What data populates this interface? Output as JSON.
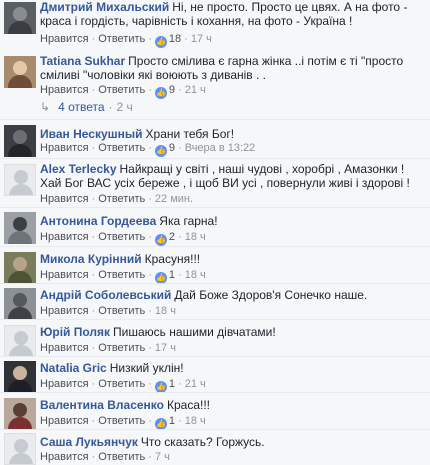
{
  "actions": {
    "like": "Нравится",
    "reply": "Ответить",
    "sep": "·"
  },
  "comments": [
    {
      "author": "Дмитрий Михальский",
      "text": "Ні, не просто. Просто це цвях. А на фото - краса і гордість, чарівність і кохання, на фото - Україна !",
      "likes": "18",
      "time": "17 ч",
      "avatar": "photo-dark"
    },
    {
      "author": "Tatiana Sukhar",
      "text": "Просто смілива є гарна жінка ..і потім є ті \"просто сміливі \"чоловіки які воюють з диванів . .",
      "likes": "9",
      "time": "21 ч",
      "avatar": "photo-warm"
    },
    {
      "author": "Иван Нескушный",
      "text": "Храни тебя Бог!",
      "likes": "9",
      "time": "Вчера в 13:22",
      "avatar": "photo-dark"
    },
    {
      "author": "Alex Terlecky",
      "text": "Найкращі у світі , наші чудові , хоробрі , Амазонки ! Хай Бог ВАС усіх береже , і щоб ВИ усі , повернули живі і здорові !",
      "likes": "",
      "time": "22 мин.",
      "avatar": "blank"
    },
    {
      "author": "Антонина Гордеева",
      "text": "Яка гарна!",
      "likes": "2",
      "time": "18 ч",
      "avatar": "photo-grey"
    },
    {
      "author": "Микола Курінний",
      "text": "Красуня!!!",
      "likes": "1",
      "time": "18 ч",
      "avatar": "photo-olive"
    },
    {
      "author": "Андрій Соболевський",
      "text": "Дай Боже Здоров'я Сонечко наше.",
      "likes": "",
      "time": "18 ч",
      "avatar": "photo-grey"
    },
    {
      "author": "Юрій Поляк",
      "text": "Пишаюсь нашими дівчатами!",
      "likes": "",
      "time": "17 ч",
      "avatar": "blank"
    },
    {
      "author": "Natalia Gric",
      "text": "Низкий уклін!",
      "likes": "1",
      "time": "21 ч",
      "avatar": "photo-dark"
    },
    {
      "author": "Валентина Власенко",
      "text": "Краса!!!",
      "likes": "1",
      "time": "18 ч",
      "avatar": "photo-warm"
    },
    {
      "author": "Саша Лукьянчук",
      "text": "Что сказать? Горжусь.",
      "likes": "",
      "time": "7 ч",
      "avatar": "blank"
    }
  ],
  "replies_label": "4 ответа",
  "replies_time": "2 ч",
  "colors": {
    "link": "#365899",
    "like_badge": "#5890ff",
    "meta": "#90949c"
  }
}
